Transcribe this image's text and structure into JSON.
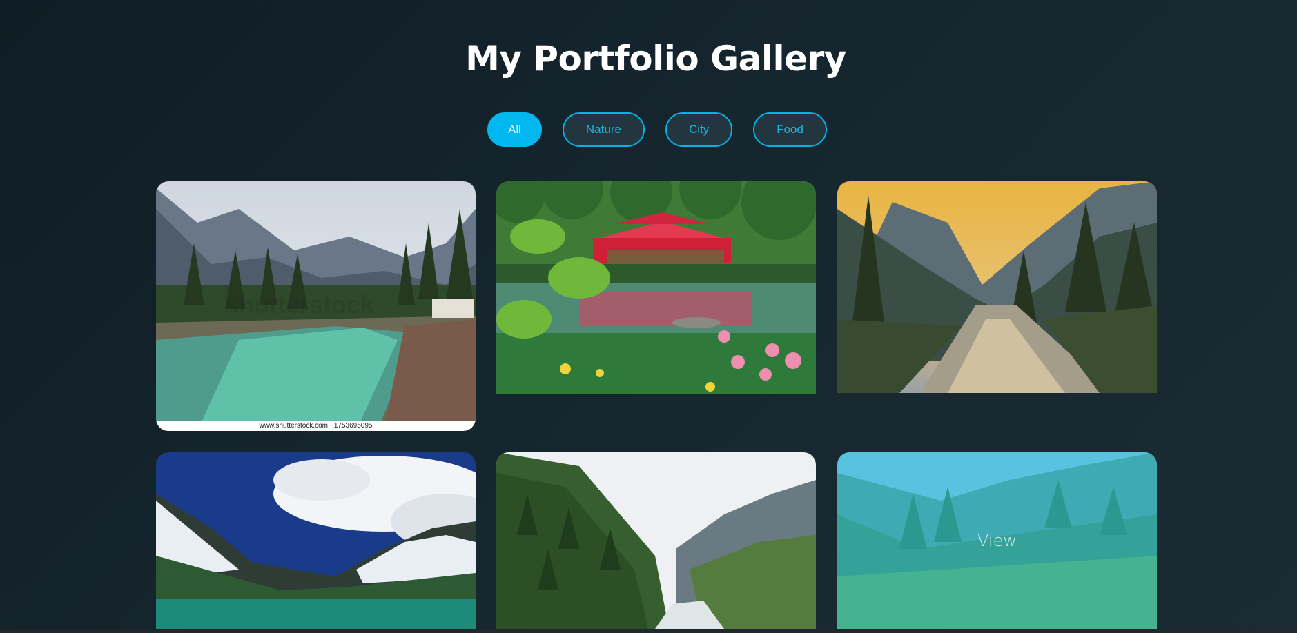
{
  "page": {
    "title": "My Portfolio Gallery"
  },
  "filters": [
    {
      "label": "All",
      "active": true
    },
    {
      "label": "Nature",
      "active": false
    },
    {
      "label": "City",
      "active": false
    },
    {
      "label": "Food",
      "active": false
    }
  ],
  "gallery": {
    "items": [
      {
        "name": "river-valley-photo",
        "footer": "www.shutterstock.com · 1753695095",
        "watermark": "shutterstock"
      },
      {
        "name": "lake-pagoda-photo"
      },
      {
        "name": "sunset-river-photo"
      },
      {
        "name": "mountain-lake-photo"
      },
      {
        "name": "forest-valley-photo"
      },
      {
        "name": "green-valley-photo",
        "overlay_label": "View"
      }
    ]
  },
  "colors": {
    "accent": "#00b7ef",
    "background": "#16262e"
  }
}
